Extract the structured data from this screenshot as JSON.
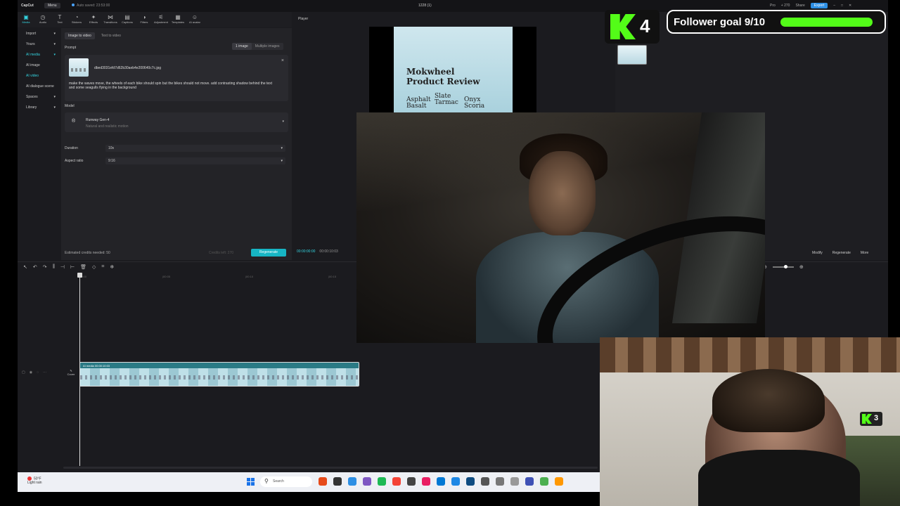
{
  "titlebar": {
    "app_name": "CapCut",
    "menu": "Menu",
    "autosave": "Auto saved: 23:53:00",
    "project": "1228 (1)",
    "pro": "Pro",
    "credits": "+ 270",
    "share": "Share",
    "export": "Export"
  },
  "toolbar": {
    "tools": [
      "Media",
      "Audio",
      "Text",
      "Stickers",
      "Effects",
      "Transitions",
      "Captions",
      "Filters",
      "Adjustment",
      "Templates",
      "AI avatar"
    ]
  },
  "sidebar": {
    "items": [
      "Import",
      "Yours",
      "AI media",
      "AI image",
      "AI video",
      "AI dialogue scene",
      "Spaces",
      "Library"
    ]
  },
  "panel": {
    "tabs": [
      "Image to video",
      "Text to video"
    ],
    "prompt_label": "Prompt",
    "image_tabs": [
      "1 image",
      "Multiple images"
    ],
    "file_name": "dbed3031efd7d62b30aeb4e200640c7c.jpg",
    "prompt_text": "make the waves move, the wheels of each bike should spin but the bikes should not move. add contrasting shadow behind the text and some seagulls flying in the background",
    "model_label": "Model",
    "model_name": "Runway Gen-4",
    "model_desc": "Natural and realistic motion",
    "duration_label": "Duration",
    "duration_value": "10s",
    "aspect_label": "Aspect ratio",
    "aspect_value": "9:16",
    "credits_text": "Estimated credits needed: 50",
    "cost_text": "Credits left: 270",
    "regenerate": "Regenerate"
  },
  "player": {
    "header": "Player",
    "poster_title_1": "Mokwheel",
    "poster_title_2": "Product Review",
    "poster_words": [
      "Asphalt",
      "Basalt",
      "Slate",
      "Tarmac",
      "Onyx",
      "Scoria"
    ],
    "time_current": "00:00:00:00",
    "time_total": "00:00:10:03"
  },
  "right_panel": {
    "buttons": [
      "Modify",
      "Regenerate",
      "More"
    ]
  },
  "timeline": {
    "ruler": [
      "00:00",
      "|00:05",
      "|00:10",
      "|00:15",
      "|00:20"
    ],
    "clip_label": "AI media  00:00:10:03",
    "cover_label": "Cover"
  },
  "taskbar": {
    "weather_temp": "50°F",
    "weather_desc": "Light rain",
    "search": "Search",
    "app_colors": [
      "#e64a19",
      "#333333",
      "#2d8fe4",
      "#7e57c2",
      "#1db954",
      "#f44336",
      "#444444",
      "#e91e63",
      "#0078d4",
      "#1e88e5",
      "#0f4c81",
      "#555555",
      "#777777",
      "#999999",
      "#3f51b5",
      "#4caf50",
      "#ff9800"
    ]
  },
  "overlay": {
    "kick_followers": "4",
    "goal_text": "Follower goal 9/10",
    "goal_progress": 0.9,
    "webcam_badge": "3",
    "kick_color": "#53fc18"
  }
}
